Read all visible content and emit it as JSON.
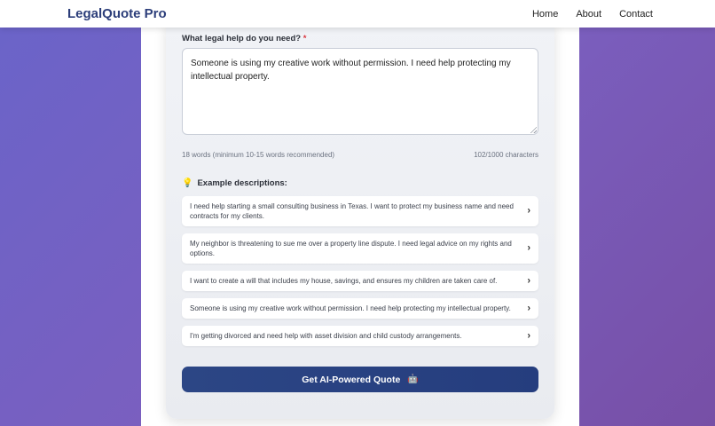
{
  "nav": {
    "brand": "LegalQuote Pro",
    "links": [
      "Home",
      "About",
      "Contact"
    ]
  },
  "form": {
    "label": "What legal help do you need?",
    "required_mark": "*",
    "textarea_value": "Someone is using my creative work without permission. I need help protecting my intellectual property.",
    "word_count": "18 words (minimum 10-15 words recommended)",
    "char_count": "102/1000 characters"
  },
  "examples": {
    "heading": "Example descriptions:",
    "heading_icon": "lightbulb-icon",
    "items": [
      "I need help starting a small consulting business in Texas. I want to protect my business name and need contracts for my clients.",
      "My neighbor is threatening to sue me over a property line dispute. I need legal advice on my rights and options.",
      "I want to create a will that includes my house, savings, and ensures my children are taken care of.",
      "Someone is using my creative work without permission. I need help protecting my intellectual property.",
      "I'm getting divorced and need help with asset division and child custody arrangements."
    ]
  },
  "submit": {
    "label": "Get AI-Powered Quote",
    "icon": "robot-icon"
  },
  "colors": {
    "brand": "#2c3e7a",
    "button": "#263f80",
    "required": "#d9363e",
    "background_start": "#6a64c9",
    "background_end": "#774fa6"
  }
}
